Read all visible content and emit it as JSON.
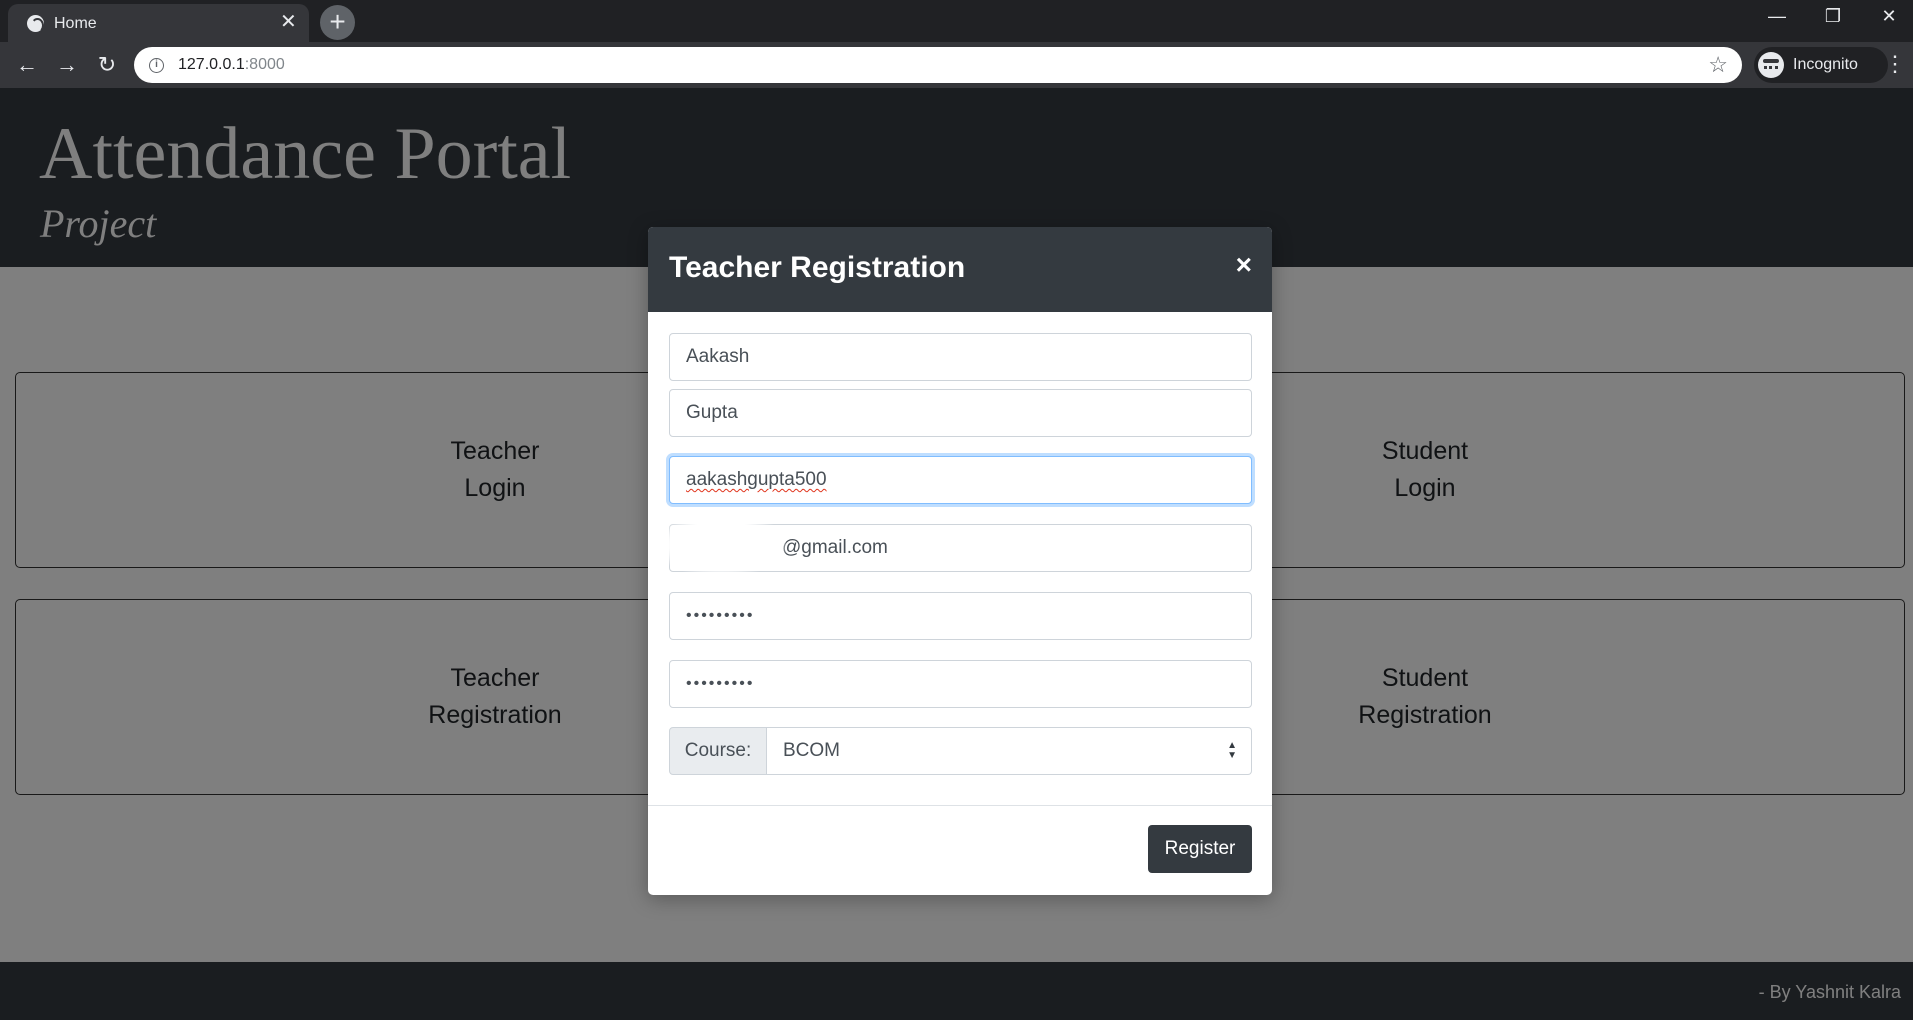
{
  "browser": {
    "tab_title": "Home",
    "url_host": "127.0.0.1",
    "url_port": ":8000",
    "incognito_label": "Incognito"
  },
  "header": {
    "title": "Attendance Portal",
    "subtitle": "Project"
  },
  "cards": [
    {
      "label": "Teacher\nLogin"
    },
    {
      "label": "Student\nLogin"
    },
    {
      "label": "Teacher\nRegistration"
    },
    {
      "label": "Student\nRegistration"
    }
  ],
  "footer": {
    "text": "- By Yashnit Kalra"
  },
  "modal": {
    "title": "Teacher Registration",
    "close_glyph": "×",
    "fields": {
      "first_name": "Aakash",
      "last_name": "Gupta",
      "username": "aakashgupta500",
      "email_visible": "@gmail.com",
      "password": "•••••••••",
      "confirm_password": "•••••••••"
    },
    "course_label": "Course:",
    "course_value": "BCOM",
    "register_label": "Register"
  },
  "colors": {
    "dark": "#343a40",
    "chrome_bg": "#202124",
    "focus_border": "#80bdff"
  }
}
